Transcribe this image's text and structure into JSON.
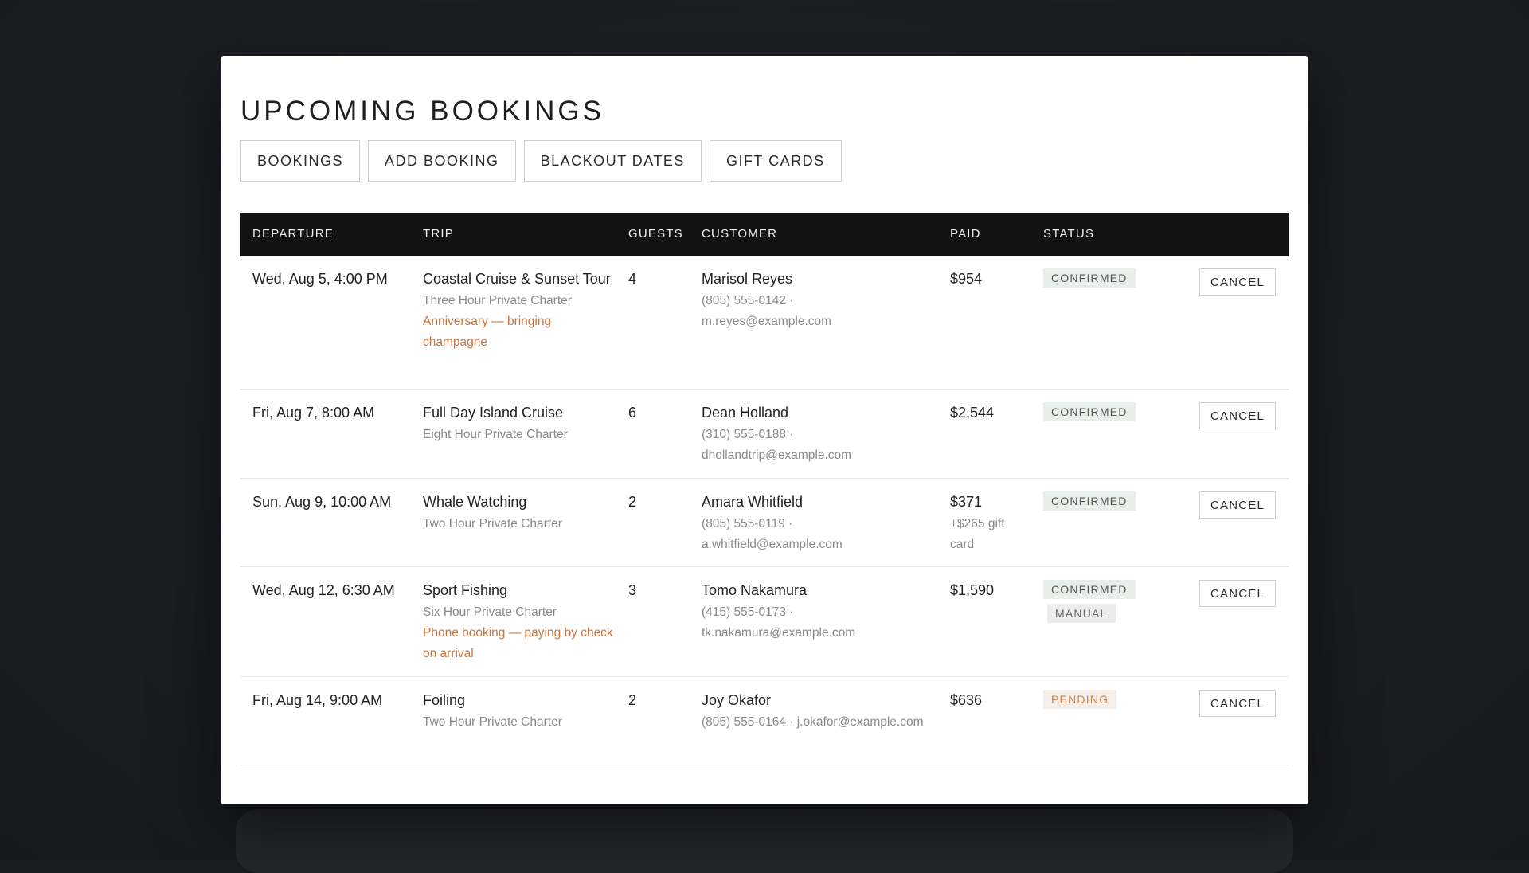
{
  "page": {
    "title": "UPCOMING BOOKINGS"
  },
  "tabs": [
    {
      "label": "BOOKINGS"
    },
    {
      "label": "ADD BOOKING"
    },
    {
      "label": "BLACKOUT DATES"
    },
    {
      "label": "GIFT CARDS"
    }
  ],
  "table": {
    "headers": {
      "departure": "DEPARTURE",
      "trip": "TRIP",
      "guests": "GUESTS",
      "customer": "CUSTOMER",
      "paid": "PAID",
      "status": "STATUS"
    },
    "cancel_label": "CANCEL",
    "rows": [
      {
        "departure": "Wed, Aug 5, 4:00 PM",
        "trip": "Coastal Cruise & Sunset Tour",
        "charter": "Three Hour Private Charter",
        "note": "Anniversary — bringing champagne",
        "guests": "4",
        "customer": "Marisol Reyes",
        "contact": "(805) 555-0142 · m.reyes@example.com",
        "paid": "$954",
        "paid_extra": "",
        "status": "CONFIRMED",
        "status_extra": ""
      },
      {
        "departure": "Fri, Aug 7, 8:00 AM",
        "trip": "Full Day Island Cruise",
        "charter": "Eight Hour Private Charter",
        "note": "",
        "guests": "6",
        "customer": "Dean Holland",
        "contact": "(310) 555-0188 · dhollandtrip@example.com",
        "paid": "$2,544",
        "paid_extra": "",
        "status": "CONFIRMED",
        "status_extra": ""
      },
      {
        "departure": "Sun, Aug 9, 10:00 AM",
        "trip": "Whale Watching",
        "charter": "Two Hour Private Charter",
        "note": "",
        "guests": "2",
        "customer": "Amara Whitfield",
        "contact": "(805) 555-0119 · a.whitfield@example.com",
        "paid": "$371",
        "paid_extra": "+$265 gift card",
        "status": "CONFIRMED",
        "status_extra": ""
      },
      {
        "departure": "Wed, Aug 12, 6:30 AM",
        "trip": "Sport Fishing",
        "charter": "Six Hour Private Charter",
        "note": "Phone booking — paying by check on arrival",
        "guests": "3",
        "customer": "Tomo Nakamura",
        "contact": "(415) 555-0173 · tk.nakamura@example.com",
        "paid": "$1,590",
        "paid_extra": "",
        "status": "CONFIRMED",
        "status_extra": "MANUAL"
      },
      {
        "departure": "Fri, Aug 14, 9:00 AM",
        "trip": "Foiling",
        "charter": "Two Hour Private Charter",
        "note": "",
        "guests": "2",
        "customer": "Joy Okafor",
        "contact": "(805) 555-0164 · j.okafor@example.com",
        "paid": "$636",
        "paid_extra": "",
        "status": "PENDING",
        "status_extra": ""
      }
    ]
  },
  "colors": {
    "header_bg": "#131313",
    "note_accent": "#c8753f",
    "pending_text": "#cf8753",
    "confirmed_bg": "#e8eeea",
    "backdrop": "#1b1d22"
  }
}
